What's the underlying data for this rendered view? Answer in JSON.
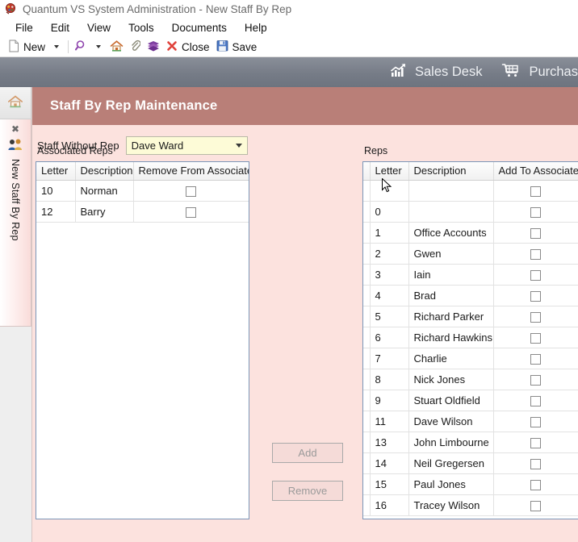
{
  "titlebar": {
    "app_title": "Quantum VS System Administration -",
    "document_title": "New Staff By Rep",
    "app_icon": "quantum-app-icon"
  },
  "menubar": {
    "items": [
      {
        "label": "File"
      },
      {
        "label": "Edit"
      },
      {
        "label": "View"
      },
      {
        "label": "Tools"
      },
      {
        "label": "Documents"
      },
      {
        "label": "Help"
      }
    ]
  },
  "toolbar": {
    "new_label": "New",
    "new_icon": "new-document-icon",
    "new_dropdown_icon": "chevron-down-icon",
    "search_icon": "magnifier-icon",
    "search_dropdown_icon": "chevron-down-icon",
    "home_icon": "home-icon",
    "attach_icon": "paperclip-icon",
    "book_icon": "book-icon",
    "close_icon": "red-x-icon",
    "close_label": "Close",
    "save_icon": "floppy-disk-icon",
    "save_label": "Save"
  },
  "ribbon": {
    "items": [
      {
        "label": "Sales Desk",
        "icon": "chart-growth-icon"
      },
      {
        "label": "Purchas",
        "icon": "shopping-cart-icon"
      }
    ]
  },
  "tabstrip": {
    "home_tab_icon": "home-icon",
    "document_tab": {
      "close_icon": "close-x-icon",
      "icon": "staff-people-icon",
      "label": "New Staff By Rep"
    }
  },
  "form": {
    "header_title": "Staff By Rep Maintenance",
    "staff_without_rep": {
      "label": "Staff Without Rep",
      "value": "Dave Ward",
      "dropdown_icon": "chevron-down-icon"
    },
    "associated_reps": {
      "caption": "Associated Reps",
      "columns": [
        "Letter",
        "Description",
        "Remove From Associated"
      ],
      "rows": [
        {
          "letter": "10",
          "description": "Norman",
          "checked": false
        },
        {
          "letter": "12",
          "description": "Barry",
          "checked": false
        }
      ]
    },
    "reps": {
      "caption": "Reps",
      "columns": [
        "Letter",
        "Description",
        "Add To Associated"
      ],
      "rows": [
        {
          "letter": "",
          "description": "",
          "checked": false
        },
        {
          "letter": "0",
          "description": "",
          "checked": false
        },
        {
          "letter": "1",
          "description": "Office Accounts",
          "checked": false
        },
        {
          "letter": "2",
          "description": "Gwen",
          "checked": false
        },
        {
          "letter": "3",
          "description": "Iain",
          "checked": false
        },
        {
          "letter": "4",
          "description": "Brad",
          "checked": false
        },
        {
          "letter": "5",
          "description": "Richard Parker",
          "checked": false
        },
        {
          "letter": "6",
          "description": "Richard Hawkins",
          "checked": false
        },
        {
          "letter": "7",
          "description": "Charlie",
          "checked": false
        },
        {
          "letter": "8",
          "description": "Nick Jones",
          "checked": false
        },
        {
          "letter": "9",
          "description": "Stuart Oldfield",
          "checked": false
        },
        {
          "letter": "11",
          "description": "Dave Wilson",
          "checked": false
        },
        {
          "letter": "13",
          "description": "John Limbourne",
          "checked": false
        },
        {
          "letter": "14",
          "description": "Neil Gregersen",
          "checked": false
        },
        {
          "letter": "15",
          "description": "Paul Jones",
          "checked": false
        },
        {
          "letter": "16",
          "description": "Tracey Wilson",
          "checked": false
        }
      ]
    },
    "add_button": {
      "label": "Add",
      "enabled": false
    },
    "remove_button": {
      "label": "Remove",
      "enabled": false
    }
  },
  "colors": {
    "form_header": "#b97f78",
    "form_background": "#fce2de",
    "ribbon": "#767c87",
    "combo_background": "#fdfbd7",
    "grid_border": "#7b96b8"
  }
}
